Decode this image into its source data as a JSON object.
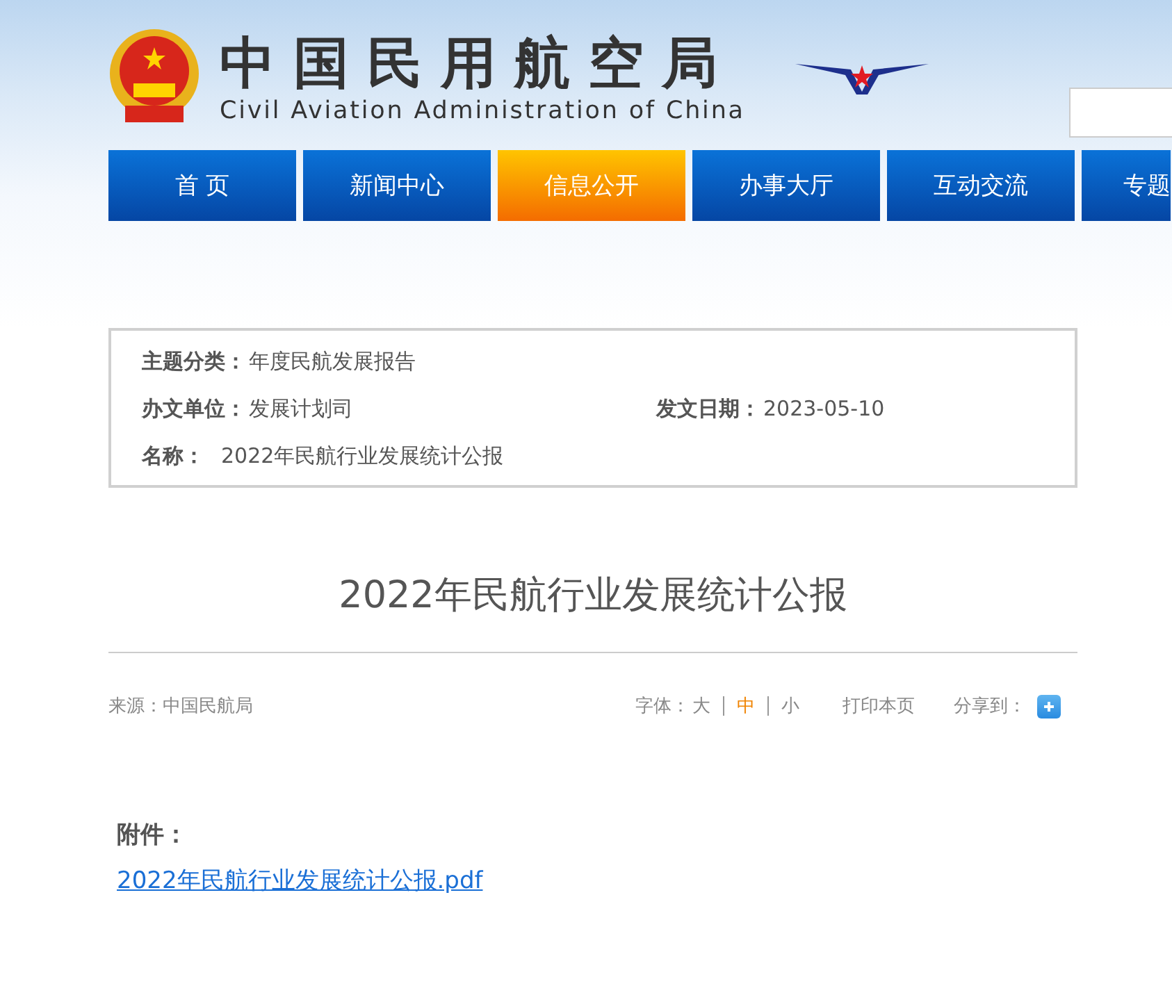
{
  "header": {
    "title_cn": "中国民用航空局",
    "title_en": "Civil Aviation Administration of China"
  },
  "nav": [
    {
      "label": "首 页",
      "selected": false
    },
    {
      "label": "新闻中心",
      "selected": false
    },
    {
      "label": "信息公开",
      "selected": true
    },
    {
      "label": "办事大厅",
      "selected": false
    },
    {
      "label": "互动交流",
      "selected": false
    },
    {
      "label": "专题",
      "selected": false
    }
  ],
  "info": {
    "rows": [
      [
        {
          "label": "主题分类：",
          "value": "年度民航发展报告"
        }
      ],
      [
        {
          "label": "办文单位：",
          "value": "发展计划司"
        },
        {
          "label": "发文日期：",
          "value": "2023-05-10"
        }
      ],
      [
        {
          "label": "名称：",
          "value": "2022年民航行业发展统计公报"
        }
      ]
    ]
  },
  "article": {
    "title": "2022年民航行业发展统计公报",
    "source": "来源：中国民航局",
    "font_size": {
      "label": "字体：",
      "options": [
        {
          "label": "大",
          "selected": false
        },
        {
          "label": "中",
          "selected": true
        },
        {
          "label": "小",
          "selected": false
        }
      ]
    },
    "print": "打印本页",
    "share": "分享到：",
    "attachment_label": "附件：",
    "attachment_link": "2022年民航行业发展统计公报.pdf"
  }
}
